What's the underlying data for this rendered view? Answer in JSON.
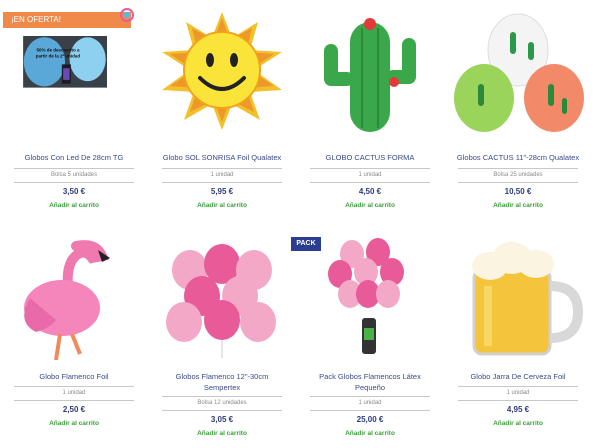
{
  "badges": {
    "offer": "¡EN OFERTA!",
    "pack": "PACK"
  },
  "promo_text": {
    "line1": "50% de descuento a",
    "line2": "partir de la 2ª unidad"
  },
  "products": [
    {
      "name": "Globos Con Led De 28cm TG",
      "unit": "Bolsa 5 unidades",
      "price": "3,50 €",
      "cart": "Añadir al carrito"
    },
    {
      "name": "Globo SOL SONRISA Foil Qualatex",
      "unit": "1 unidad",
      "price": "5,95 €",
      "cart": "Añadir al carrito"
    },
    {
      "name": "GLOBO CACTUS FORMA",
      "unit": "1 unidad",
      "price": "4,50 €",
      "cart": "Añadir al carrito"
    },
    {
      "name": "Globos CACTUS 11\"-28cm Qualatex",
      "unit": "Bolsa 25 unidades",
      "price": "10,50 €",
      "cart": "Añadir al carrito"
    },
    {
      "name": "Globo Flamenco Foil",
      "unit": "1 unidad",
      "price": "2,50 €",
      "cart": "Añadir al carrito"
    },
    {
      "name_line1": "Globos Flamenco 12\"-30cm",
      "name_line2": "Sempertex",
      "unit": "Bolsa 12 unidades",
      "price": "3,05 €",
      "cart": "Añadir al carrito"
    },
    {
      "name_line1": "Pack Globos Flamencos Látex",
      "name_line2": "Pequeño",
      "unit": "1 unidad",
      "price": "25,00 €",
      "cart": "Añadir al carrito"
    },
    {
      "name": "Globo Jarra De Cerveza Foil",
      "unit": "1 unidad",
      "price": "4,95 €",
      "cart": "Añadir al carrito"
    }
  ],
  "colors": {
    "offer": "#f08a4b",
    "pack": "#2a3d91",
    "name": "#3a4a8a",
    "price": "#2e3b7a",
    "cart": "#3aa13a"
  }
}
